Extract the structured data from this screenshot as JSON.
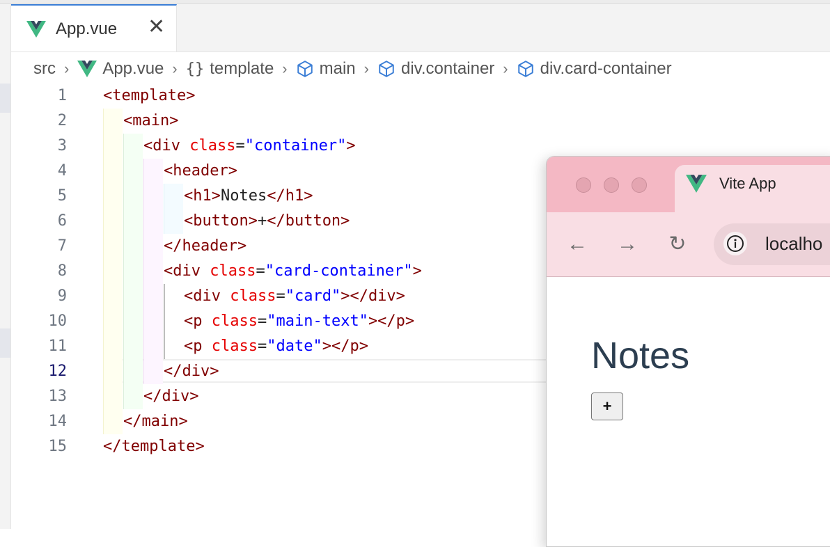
{
  "editor_tab": {
    "label": "App.vue",
    "close_glyph": "✕",
    "icon": "vue-logo"
  },
  "breadcrumb": {
    "items": [
      "src",
      "App.vue",
      "template",
      "main",
      "div.container",
      "div.card-container"
    ],
    "braces_glyph": "{}",
    "separator": "›"
  },
  "code": {
    "active_line": 12,
    "line_numbers": [
      "1",
      "2",
      "3",
      "4",
      "5",
      "6",
      "7",
      "8",
      "9",
      "10",
      "11",
      "12",
      "13",
      "14",
      "15"
    ],
    "tokens": {
      "l1": {
        "t1": "<template>"
      },
      "l2": {
        "t1": "<main>"
      },
      "l3": {
        "t1": "<div",
        "a1": "class",
        "e1": "=",
        "s1": "\"container\"",
        "t2": ">"
      },
      "l4": {
        "t1": "<header>"
      },
      "l5": {
        "t1": "<h1>",
        "x1": "Notes",
        "t2": "</h1>"
      },
      "l6": {
        "t1": "<button>",
        "x1": "+",
        "t2": "</button>"
      },
      "l7": {
        "t1": "</header>"
      },
      "l8": {
        "t1": "<div",
        "a1": "class",
        "e1": "=",
        "s1": "\"card-container\"",
        "t2": ">"
      },
      "l9": {
        "t1": "<div",
        "a1": "class",
        "e1": "=",
        "s1": "\"card\"",
        "t2": "></div>"
      },
      "l10": {
        "t1": "<p",
        "a1": "class",
        "e1": "=",
        "s1": "\"main-text\"",
        "t2": "></p>"
      },
      "l11": {
        "t1": "<p",
        "a1": "class",
        "e1": "=",
        "s1": "\"date\"",
        "t2": "></p>"
      },
      "l12": {
        "t1": "</div>"
      },
      "l13": {
        "t1": "</div>"
      },
      "l14": {
        "t1": "</main>"
      },
      "l15": {
        "t1": "</template>"
      }
    }
  },
  "browser": {
    "tab_title": "Vite App",
    "url_partial": "localho",
    "nav": {
      "back_glyph": "←",
      "forward_glyph": "→",
      "reload_glyph": "↻"
    },
    "page": {
      "heading": "Notes",
      "button_label": "+"
    }
  },
  "colors": {
    "tag": "#800000",
    "attr": "#e50000",
    "string": "#0000ff",
    "vue_green": "#41b883",
    "vue_dark": "#34495e",
    "accent_blue": "#3b7ed6",
    "browser_titlebar": "#f4b8c4"
  }
}
